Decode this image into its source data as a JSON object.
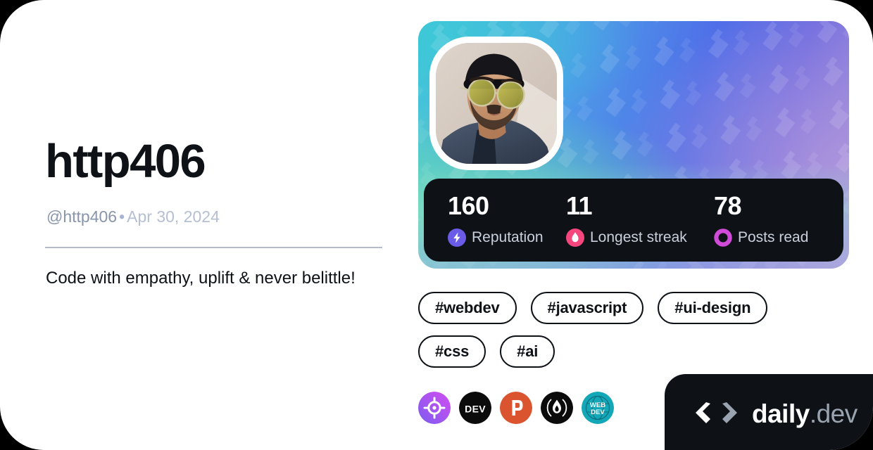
{
  "card": {
    "background": "#ffffff",
    "page_background": "#000000"
  },
  "profile": {
    "name": "http406",
    "handle": "@http406",
    "separator": "•",
    "date": "Apr 30, 2024",
    "bio": "Code with empathy, uplift & never belittle!",
    "avatar_alt": "user-avatar-photo"
  },
  "cover": {
    "gradient_from": "#49c6d8",
    "gradient_mid": "#4f6fe8",
    "gradient_to": "#9b8ad8",
    "watermark_icon": "daily-dev-chevron-watermark"
  },
  "stats": {
    "background": "#0e1217",
    "items": [
      {
        "value": "160",
        "label": "Reputation",
        "icon": "reputation-bolt-icon",
        "color": "#6b5ce7"
      },
      {
        "value": "11",
        "label": "Longest streak",
        "icon": "streak-flame-icon",
        "color": "#f5477e"
      },
      {
        "value": "78",
        "label": "Posts read",
        "icon": "posts-read-ring-icon",
        "color": "#cf4bd8"
      }
    ]
  },
  "tags": [
    {
      "label": "#webdev"
    },
    {
      "label": "#javascript"
    },
    {
      "label": "#ui-design"
    },
    {
      "label": "#css"
    },
    {
      "label": "#ai"
    }
  ],
  "socials": [
    {
      "name": "codepen-target-icon",
      "title": "target"
    },
    {
      "name": "dev-to-icon",
      "title": "DEV"
    },
    {
      "name": "product-hunt-icon",
      "title": "P"
    },
    {
      "name": "hashnode-flame-icon",
      "title": "flame"
    },
    {
      "name": "webdev-globe-icon",
      "title": "WEB DEV"
    }
  ],
  "brand": {
    "name": "daily",
    "tld": ".dev",
    "logo_icon": "daily-dev-logo-icon",
    "background": "#0e1217"
  }
}
